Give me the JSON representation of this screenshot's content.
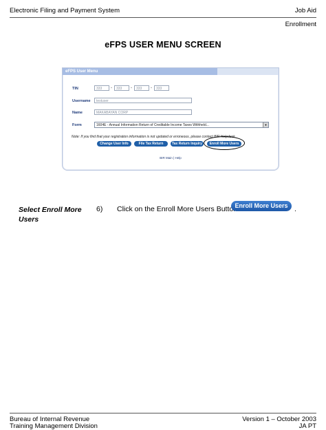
{
  "header": {
    "left": "Electronic Filing and Payment System",
    "right": "Job Aid",
    "sub": "Enrollment"
  },
  "title": "eFPS USER MENU SCREEN",
  "screen": {
    "panel_title": "eFPS User Menu",
    "tin_label": "TIN",
    "tin_values": [
      "333",
      "333",
      "333",
      "333"
    ],
    "username_label": "Username",
    "username_value": "testuser",
    "name_label": "Name",
    "name_value": "MAKABAYAN CORP",
    "form_label": "Form",
    "form_value": "1604E - Annual Information Return of Creditable Income Taxes Withheld...",
    "note": "Note: If you find that your registration information is not updated or erroneous, please contact BIR Helpdesk.",
    "buttons": [
      "Change User Info",
      "File Tax Return",
      "Tax Return Inquiry",
      "Enroll More Users"
    ],
    "footer_links": "BIR Main | Help"
  },
  "step": {
    "label": "Select Enroll More Users",
    "number": "6)",
    "text": "Click on the Enroll More Users Button",
    "button_label": "Enroll More Users",
    "period": "."
  },
  "footer": {
    "left1": "Bureau of Internal Revenue",
    "left2": "Training Management Division",
    "right1": "Version 1 – October 2003",
    "right2": "JA PT"
  }
}
